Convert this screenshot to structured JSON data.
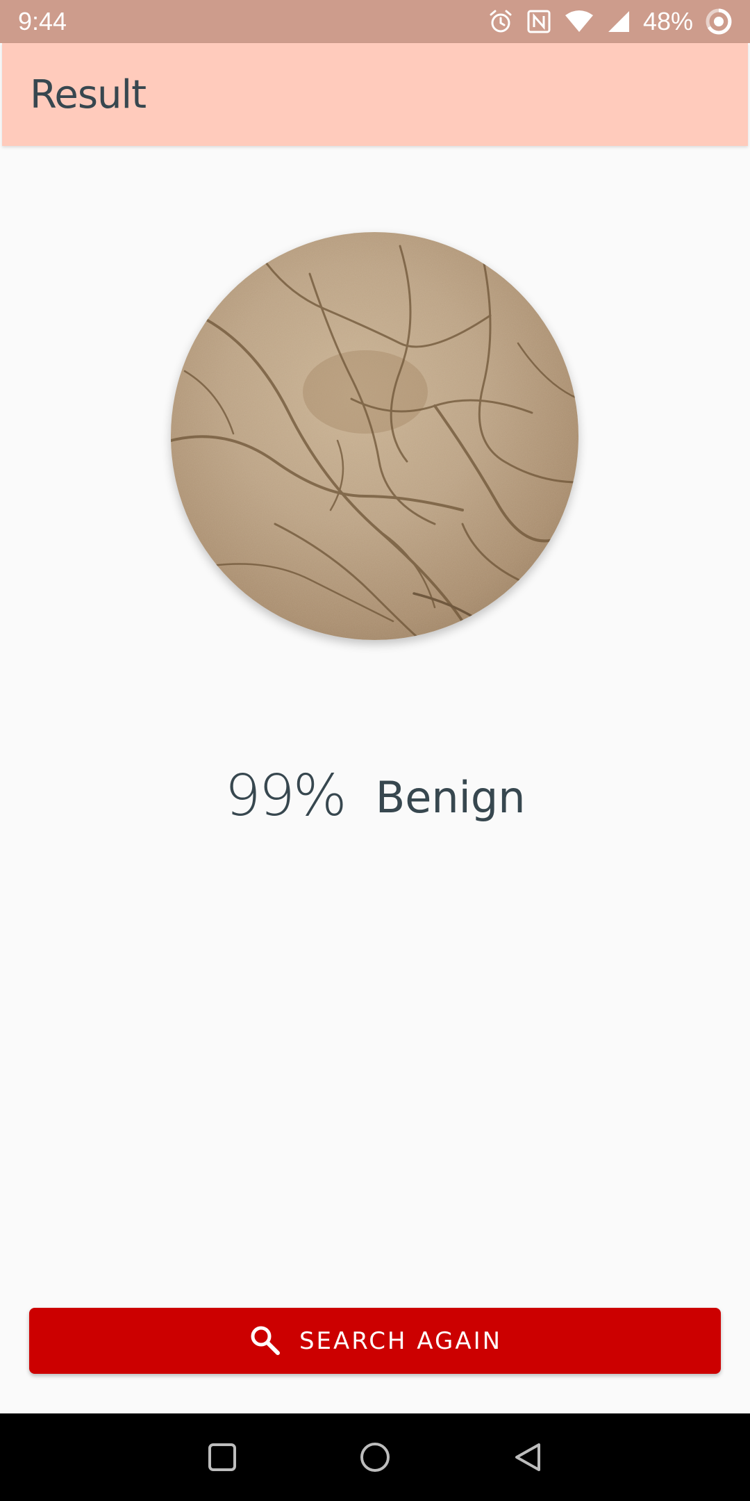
{
  "status_bar": {
    "time": "9:44",
    "battery": "48%",
    "icons": [
      "alarm-icon",
      "nfc-icon",
      "wifi-icon",
      "signal-icon",
      "battery-icon"
    ]
  },
  "app_bar": {
    "title": "Result"
  },
  "result": {
    "image_icon": "skin-lesion-photo",
    "percent": "99%",
    "label": "Benign"
  },
  "actions": {
    "search_again_label": "SEARCH AGAIN",
    "search_icon": "search-icon"
  },
  "nav_bar": {
    "buttons": [
      "recents-icon",
      "home-icon",
      "back-icon"
    ]
  },
  "colors": {
    "status_bar": "#cd9c8c",
    "app_bar": "#ffcbbc",
    "text": "#37474f",
    "button": "#cc0000",
    "background": "#fafafa"
  }
}
